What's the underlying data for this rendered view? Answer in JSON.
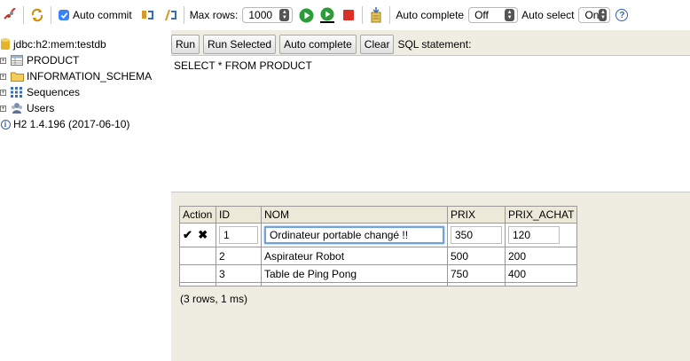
{
  "toolbar": {
    "auto_commit_label": "Auto commit",
    "max_rows_label": "Max rows:",
    "max_rows_value": "1000",
    "auto_complete_label": "Auto complete",
    "auto_complete_value": "Off",
    "auto_select_label": "Auto select",
    "auto_select_value": "On",
    "help_label": "?"
  },
  "tree": {
    "root": "jdbc:h2:mem:testdb",
    "items": [
      {
        "label": "PRODUCT",
        "icon": "table-icon"
      },
      {
        "label": "INFORMATION_SCHEMA",
        "icon": "folder-icon"
      },
      {
        "label": "Sequences",
        "icon": "sequences-icon"
      },
      {
        "label": "Users",
        "icon": "users-icon"
      }
    ],
    "version": "H2 1.4.196 (2017-06-10)"
  },
  "buttons": {
    "run": "Run",
    "run_selected": "Run Selected",
    "auto_complete": "Auto complete",
    "clear": "Clear",
    "sql_label": "SQL statement:"
  },
  "editor": {
    "text": "SELECT * FROM PRODUCT"
  },
  "result": {
    "columns": [
      "Action",
      "ID",
      "NOM",
      "PRIX",
      "PRIX_ACHAT"
    ],
    "edit_row": {
      "accept": "✔",
      "cancel": "✖",
      "id": "1",
      "nom": "Ordinateur portable changé !!",
      "prix": "350",
      "prix_achat": "120"
    },
    "rows": [
      {
        "id": "2",
        "nom": "Aspirateur Robot",
        "prix": "500",
        "prix_achat": "200"
      },
      {
        "id": "3",
        "nom": "Table de Ping Pong",
        "prix": "750",
        "prix_achat": "400"
      }
    ],
    "status": "(3 rows, 1 ms)"
  }
}
